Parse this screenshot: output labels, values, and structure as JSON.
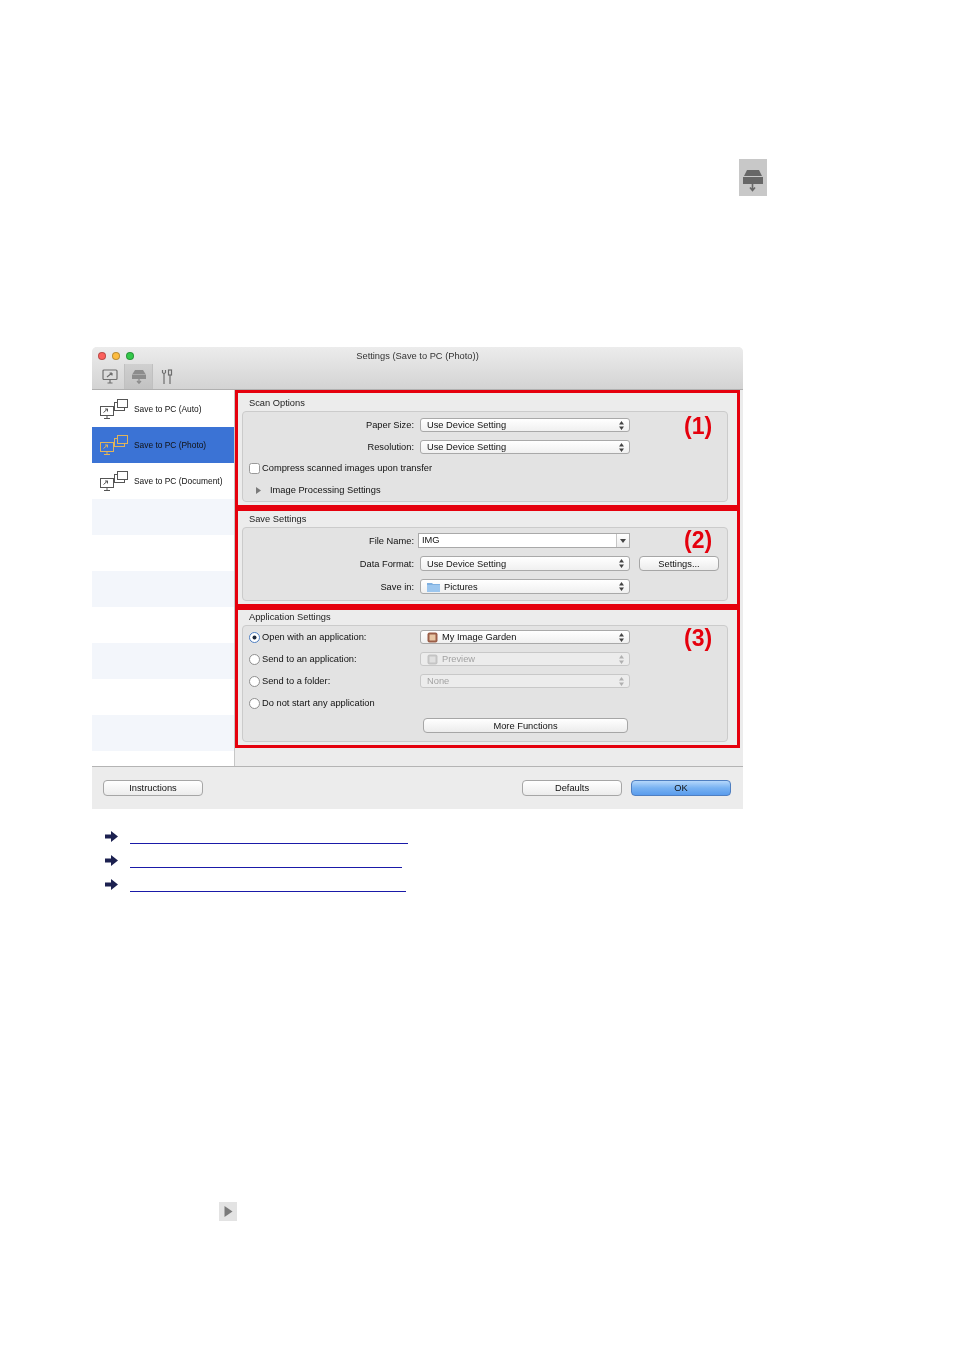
{
  "window": {
    "title": "Settings (Save to PC (Photo))",
    "toolbar": [
      {
        "selected": false
      },
      {
        "selected": true
      },
      {
        "selected": false
      }
    ]
  },
  "sidebar": {
    "items": [
      {
        "label": "Save to PC (Auto)",
        "selected": false
      },
      {
        "label": "Save to PC (Photo)",
        "selected": true
      },
      {
        "label": "Save to PC (Document)",
        "selected": false
      }
    ]
  },
  "scan_options": {
    "title": "Scan Options",
    "marker": "(1)",
    "fields": [
      {
        "label": "Paper Size:",
        "value": "Use Device Setting"
      },
      {
        "label": "Resolution:",
        "value": "Use Device Setting"
      }
    ],
    "compress": {
      "label": "Compress scanned images upon transfer",
      "checked": false
    },
    "image_processing": {
      "label": "Image Processing Settings",
      "expanded": false
    }
  },
  "save_settings": {
    "title": "Save Settings",
    "marker": "(2)",
    "file_name": {
      "label": "File Name:",
      "value": "IMG"
    },
    "data_format": {
      "label": "Data Format:",
      "value": "Use Device Setting",
      "button": "Settings..."
    },
    "save_in": {
      "label": "Save in:",
      "value": "Pictures"
    }
  },
  "application_settings": {
    "title": "Application Settings",
    "marker": "(3)",
    "options": [
      {
        "label": "Open with an application:",
        "selected": true,
        "popup": {
          "kind": "application",
          "value": "My Image Garden",
          "disabled": false
        }
      },
      {
        "label": "Send to an application:",
        "selected": false,
        "popup": {
          "kind": "application",
          "value": "Preview",
          "disabled": true
        }
      },
      {
        "label": "Send to a folder:",
        "selected": false,
        "popup": {
          "kind": "plain",
          "value": "None",
          "disabled": true
        }
      },
      {
        "label": "Do not start any application",
        "selected": false
      }
    ],
    "more_button": "More Functions"
  },
  "footer": {
    "left_buttons": [
      {
        "label": "Instructions",
        "default": false
      }
    ],
    "right_buttons": [
      {
        "label": "Defaults",
        "default": false
      },
      {
        "label": "OK",
        "default": true
      }
    ]
  },
  "related_links": [
    {
      "kind": "link"
    },
    {
      "kind": "link"
    },
    {
      "kind": "link"
    }
  ]
}
